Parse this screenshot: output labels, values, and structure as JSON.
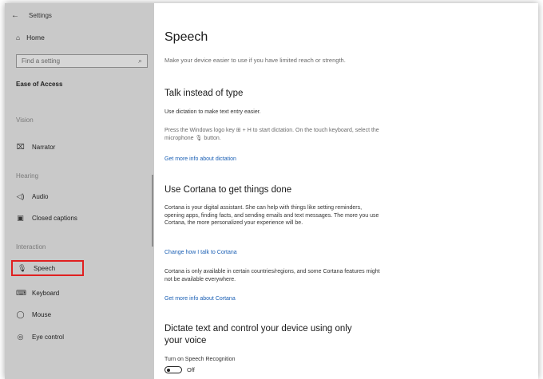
{
  "window": {
    "title": "Settings"
  },
  "sidebar": {
    "home_label": "Home",
    "search_placeholder": "Find a setting",
    "section_title": "Ease of Access",
    "groups": {
      "vision": "Vision",
      "hearing": "Hearing",
      "interaction": "Interaction"
    },
    "items": {
      "narrator": "Narrator",
      "audio": "Audio",
      "closed_captions": "Closed captions",
      "speech": "Speech",
      "keyboard": "Keyboard",
      "mouse": "Mouse",
      "eye_control": "Eye control"
    },
    "selected_item": "Speech"
  },
  "main": {
    "title": "Speech",
    "lead": "Make your device easier to use if you have limited reach or strength.",
    "talk_section": {
      "heading": "Talk instead of type",
      "desc": "Use dictation to make text entry easier.",
      "instructions": "Press the Windows logo key ⊞ + H to start dictation.  On the touch keyboard, select the microphone 🎙 button.",
      "link": "Get more info about dictation"
    },
    "cortana_section": {
      "heading": "Use Cortana to get things done",
      "desc": "Cortana is your digital assistant.  She can help with things like setting reminders, opening apps, finding facts, and sending emails and text messages.  The more you use Cortana, the more personalized your experience will be.",
      "link1": "Change how I talk to Cortana",
      "availability": "Cortana is only available in certain countries/regions, and some Cortana features might not be available everywhere.",
      "link2": "Get more info about Cortana"
    },
    "dictate_section": {
      "heading": "Dictate text and control your device using only your voice",
      "toggle_label": "Turn on Speech Recognition",
      "toggle_state": "Off"
    }
  },
  "colors": {
    "sidebar_bg": "#c9c9c9",
    "link": "#1a5fb4",
    "highlight": "#e02020"
  }
}
